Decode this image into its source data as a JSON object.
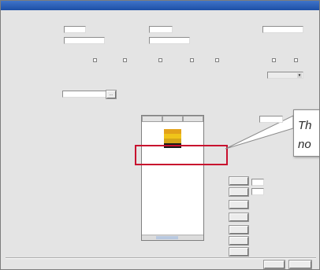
{
  "window": {
    "title": ""
  },
  "header": {
    "brand_label": "",
    "brand_value": "",
    "region_label": "",
    "region_value": "",
    "colour_code_label": "",
    "colour_code_value": "",
    "colour_name_label": "",
    "colour_name_value": "",
    "field_right_label": "",
    "field_right_value": ""
  },
  "options": {
    "prefix_label": "",
    "items": [
      "",
      "",
      "",
      "",
      "",
      "",
      ""
    ]
  },
  "form": {
    "row1_label": "",
    "row1_value": "",
    "row2_label": "",
    "row2_value": "",
    "right_label": "",
    "right_value": ""
  },
  "list": {
    "caption": "",
    "columns": [
      "",
      "",
      ""
    ],
    "rows": [
      {
        "code": "",
        "colour": "#ffffff",
        "weight": ""
      },
      {
        "code": "",
        "colour": "#e3a21a",
        "weight": ""
      },
      {
        "code": "",
        "colour": "#f0c419",
        "weight": ""
      },
      {
        "code": "",
        "colour": "#d4a51a",
        "weight": ""
      },
      {
        "code": "",
        "colour": "#1a1a1a",
        "weight": ""
      },
      {
        "code": "",
        "colour": "#ffffff",
        "weight": ""
      },
      {
        "code": "",
        "colour": "#ffffff",
        "weight": ""
      }
    ]
  },
  "right": {
    "label1": "",
    "value1": "",
    "label2": "",
    "qty1_value": "",
    "qty1_unit": "",
    "qty2_value": "",
    "qty2_unit": ""
  },
  "actions": {
    "b1": "",
    "b2": "",
    "b3": "",
    "b4": "",
    "b5": "",
    "b6": "",
    "b7": ""
  },
  "footer": {
    "ok": "",
    "cancel": ""
  },
  "callout": {
    "text": "Th\nno"
  },
  "colors": {
    "accent": "#1d4fa6",
    "highlight": "#c8102e"
  }
}
